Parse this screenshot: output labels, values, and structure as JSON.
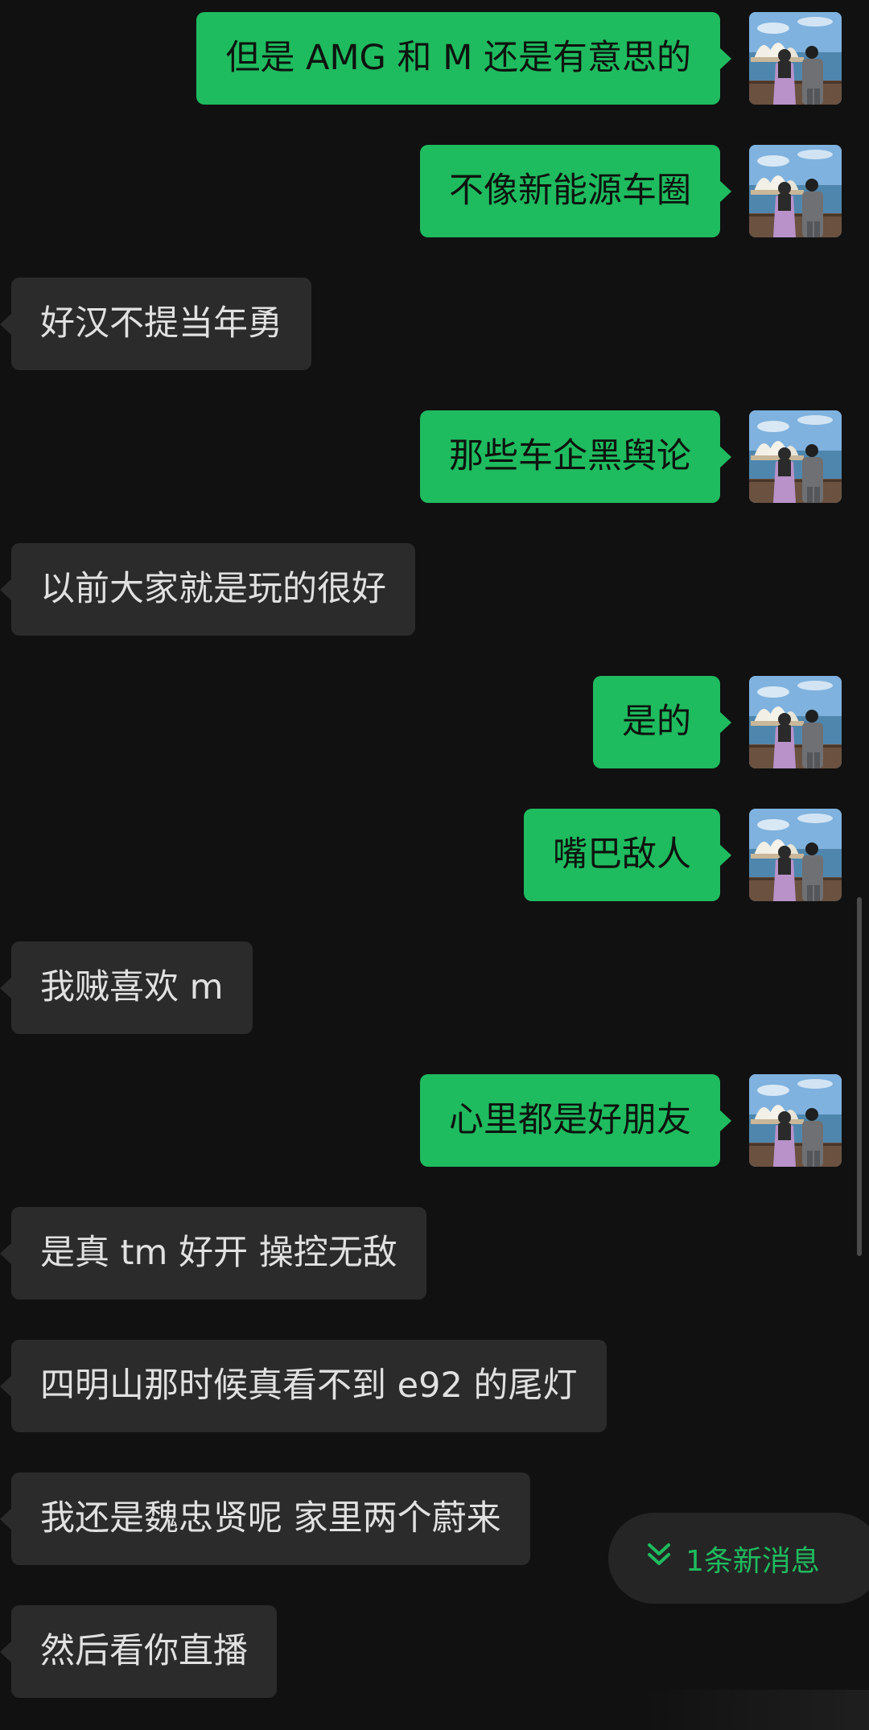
{
  "colors": {
    "background": "#111111",
    "sent_bubble": "#1fbb5f",
    "received_bubble": "#2b2b2b",
    "sent_text": "#0d130e",
    "received_text": "#e1e1e1",
    "accent": "#1fbb5f"
  },
  "messages": [
    {
      "direction": "sent",
      "text": "但是 AMG 和 M 还是有意思的",
      "avatar": "avatar-photo"
    },
    {
      "direction": "sent",
      "text": "不像新能源车圈",
      "avatar": "avatar-photo"
    },
    {
      "direction": "received",
      "text": "好汉不提当年勇"
    },
    {
      "direction": "sent",
      "text": "那些车企黑舆论",
      "avatar": "avatar-photo"
    },
    {
      "direction": "received",
      "text": "以前大家就是玩的很好"
    },
    {
      "direction": "sent",
      "text": "是的",
      "avatar": "avatar-photo"
    },
    {
      "direction": "sent",
      "text": "嘴巴敌人",
      "avatar": "avatar-photo"
    },
    {
      "direction": "received",
      "text": "我贼喜欢 m"
    },
    {
      "direction": "sent",
      "text": "心里都是好朋友",
      "avatar": "avatar-photo"
    },
    {
      "direction": "received",
      "text": "是真 tm 好开 操控无敌"
    },
    {
      "direction": "received",
      "text": "四明山那时候真看不到 e92 的尾灯"
    },
    {
      "direction": "received",
      "text": "我还是魏忠贤呢 家里两个蔚来"
    },
    {
      "direction": "received",
      "text": "然后看你直播"
    }
  ],
  "new_message_pill": {
    "icon": "double-chevron-down-icon",
    "label": "1条新消息"
  }
}
